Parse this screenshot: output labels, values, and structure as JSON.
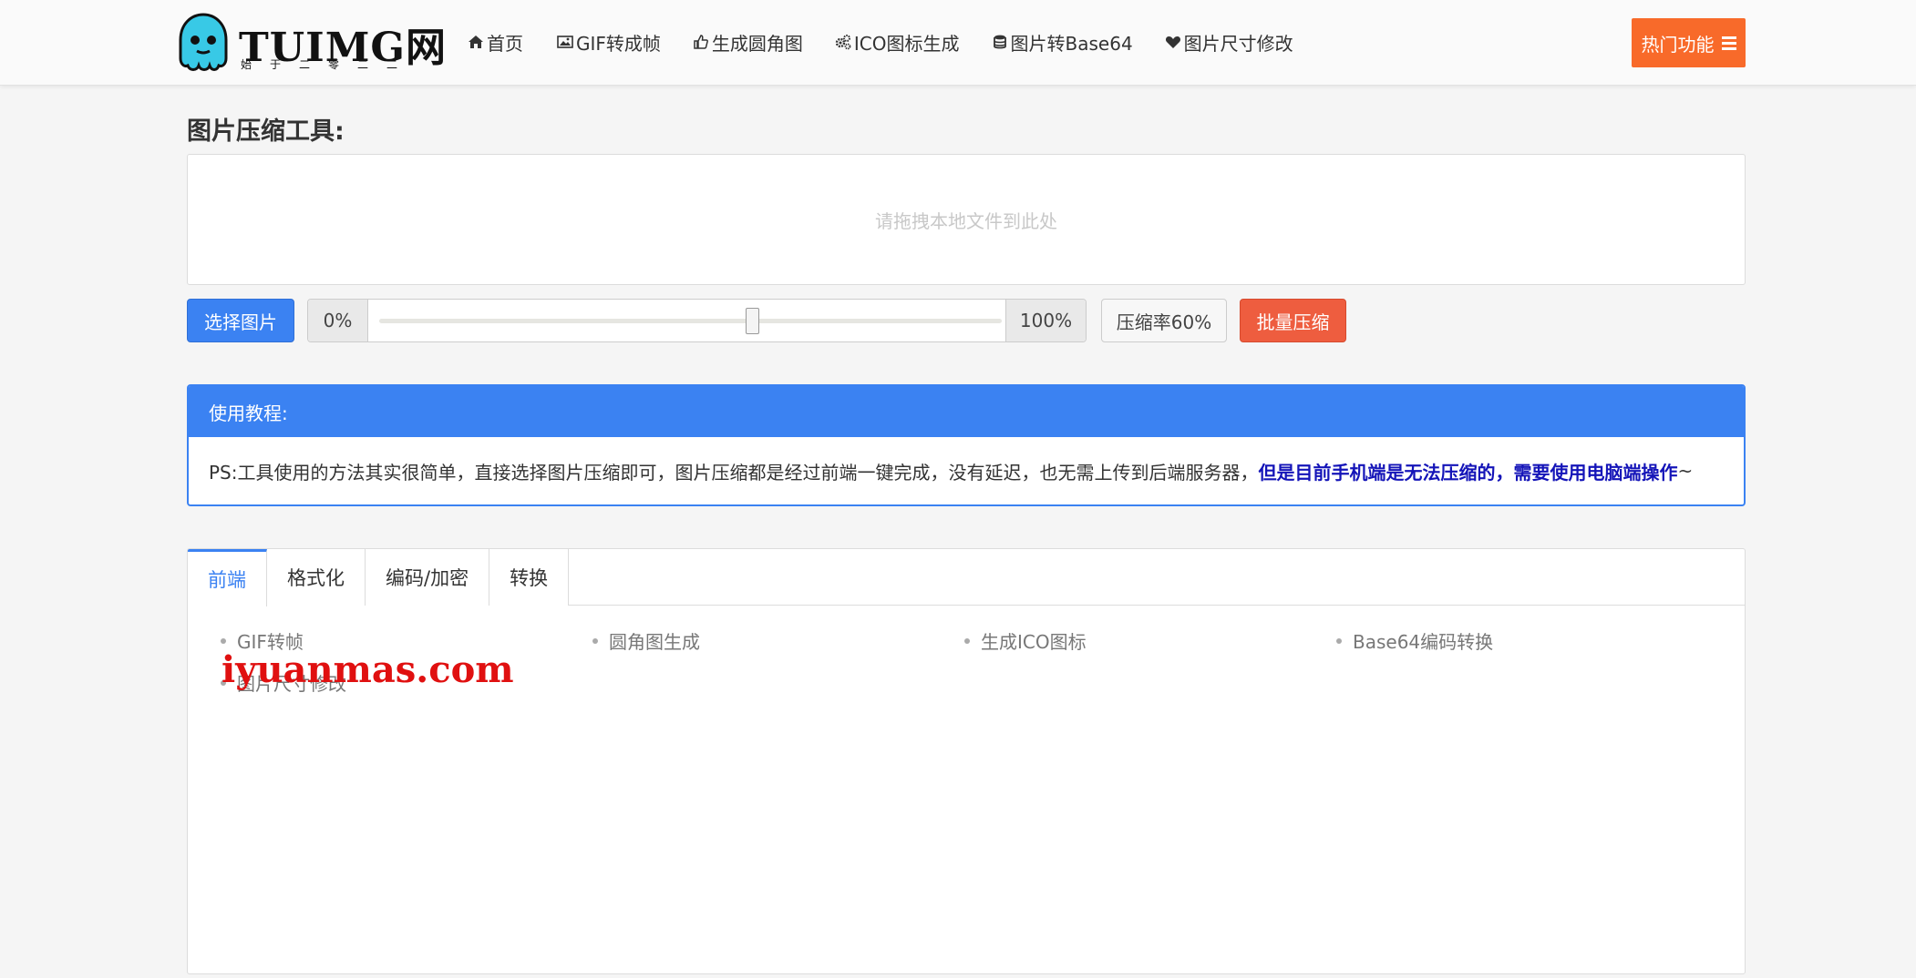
{
  "header": {
    "logo": {
      "title": "TUIMG网",
      "subtitle": "始于二零二二"
    },
    "nav": [
      {
        "label": "首页",
        "icon": "home-icon"
      },
      {
        "label": "GIF转成帧",
        "icon": "image-icon"
      },
      {
        "label": "生成圆角图",
        "icon": "thumbs-up-icon"
      },
      {
        "label": "ICO图标生成",
        "icon": "gears-icon"
      },
      {
        "label": "图片转Base64",
        "icon": "database-icon"
      },
      {
        "label": "图片尺寸修改",
        "icon": "heart-icon"
      }
    ],
    "hot_button": "热门功能",
    "accent": "#f86a2a"
  },
  "main": {
    "title": "图片压缩工具:",
    "dropzone_placeholder": "请拖拽本地文件到此处",
    "select_button": "选择图片",
    "slider": {
      "min_label": "0%",
      "max_label": "100%",
      "value": 0.6
    },
    "ratio_label": "压缩率60%",
    "batch_button": "批量压缩",
    "tutorial": {
      "title": "使用教程:",
      "text": "PS:工具使用的方法其实很简单，直接选择图片压缩即可，图片压缩都是经过前端一键完成，没有延迟，也无需上传到后端服务器，",
      "highlight": "但是目前手机端是无法压缩的，需要使用电脑端操作",
      "suffix": "~"
    },
    "tabs": [
      "前端",
      "格式化",
      "编码/加密",
      "转换"
    ],
    "active_tab": 0,
    "links": [
      "GIF转帧",
      "圆角图生成",
      "生成ICO图标",
      "Base64编码转换",
      "图片尺寸修改"
    ]
  },
  "watermark": "iyuanmas.com",
  "colors": {
    "primary": "#3b82f2",
    "danger": "#ee5d3f",
    "highlight_text": "#1414b8"
  }
}
